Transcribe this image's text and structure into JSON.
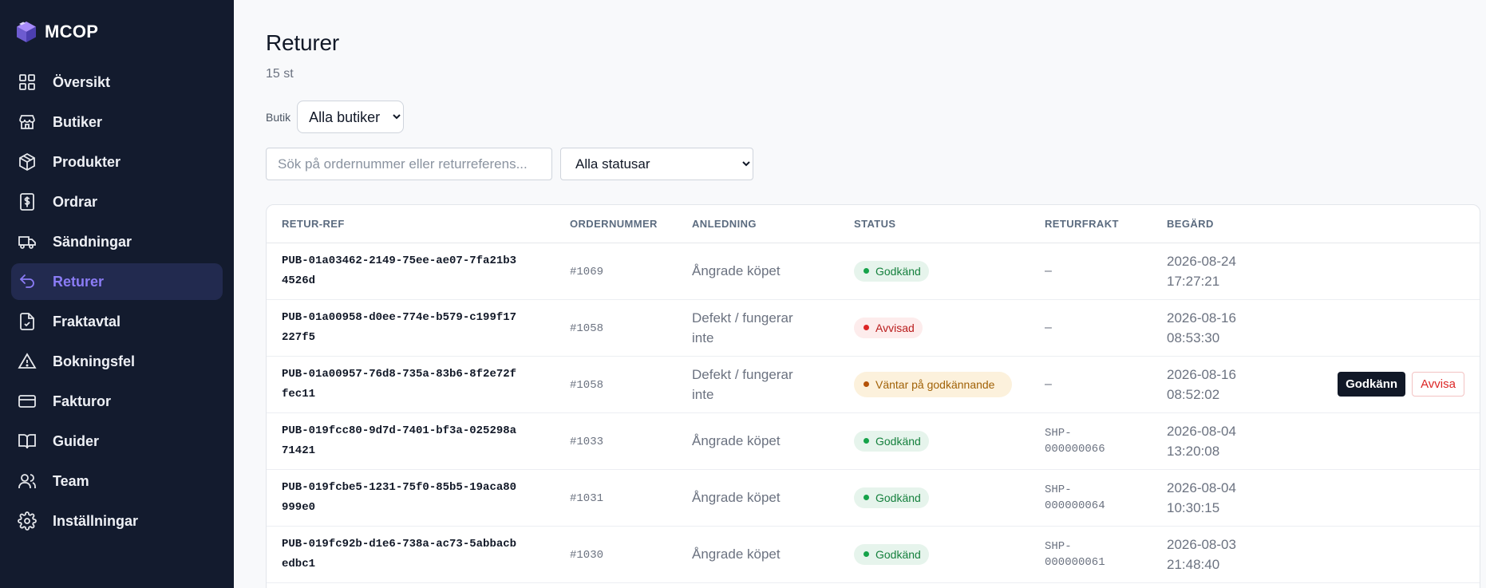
{
  "brand": {
    "name": "MCOP"
  },
  "sidebar": {
    "items": [
      {
        "label": "Översikt",
        "icon": "grid-icon"
      },
      {
        "label": "Butiker",
        "icon": "store-icon"
      },
      {
        "label": "Produkter",
        "icon": "package-icon"
      },
      {
        "label": "Ordrar",
        "icon": "dollar-document-icon"
      },
      {
        "label": "Sändningar",
        "icon": "truck-icon"
      },
      {
        "label": "Returer",
        "icon": "return-arrow-icon",
        "active": true
      },
      {
        "label": "Fraktavtal",
        "icon": "contract-icon"
      },
      {
        "label": "Bokningsfel",
        "icon": "warning-icon"
      },
      {
        "label": "Fakturor",
        "icon": "credit-card-icon"
      },
      {
        "label": "Guider",
        "icon": "book-icon"
      },
      {
        "label": "Team",
        "icon": "users-icon"
      },
      {
        "label": "Inställningar",
        "icon": "gear-icon"
      }
    ]
  },
  "page": {
    "title": "Returer",
    "count": "15 st"
  },
  "filters": {
    "shop_label": "Butik",
    "shop_value": "Alla butiker",
    "search_placeholder": "Sök på ordernummer eller returreferens...",
    "status_value": "Alla statusar"
  },
  "table": {
    "headers": {
      "ref": "RETUR-REF",
      "order": "ORDERNUMMER",
      "reason": "ANLEDNING",
      "status": "STATUS",
      "freight": "RETURFRAKT",
      "date": "BEGÄRD"
    },
    "actions": {
      "approve": "Godkänn",
      "reject": "Avvisa"
    },
    "rows": [
      {
        "ref": "PUB-01a03462-2149-75ee-ae07-7fa21b34526d",
        "order": "#1069",
        "reason": "Ångrade köpet",
        "status": "Godkänd",
        "status_type": "approved",
        "freight": "–",
        "date": "2026-08-24 17:27:21"
      },
      {
        "ref": "PUB-01a00958-d0ee-774e-b579-c199f17227f5",
        "order": "#1058",
        "reason": "Defekt / fungerar inte",
        "status": "Avvisad",
        "status_type": "rejected",
        "freight": "–",
        "date": "2026-08-16 08:53:30"
      },
      {
        "ref": "PUB-01a00957-76d8-735a-83b6-8f2e72ffec11",
        "order": "#1058",
        "reason": "Defekt / fungerar inte",
        "status": "Väntar på godkännande",
        "status_type": "pending",
        "freight": "–",
        "date": "2026-08-16 08:52:02",
        "has_actions": true
      },
      {
        "ref": "PUB-019fcc80-9d7d-7401-bf3a-025298a71421",
        "order": "#1033",
        "reason": "Ångrade köpet",
        "status": "Godkänd",
        "status_type": "approved",
        "freight": "SHP-000000066",
        "date": "2026-08-04 13:20:08"
      },
      {
        "ref": "PUB-019fcbe5-1231-75f0-85b5-19aca80999e0",
        "order": "#1031",
        "reason": "Ångrade köpet",
        "status": "Godkänd",
        "status_type": "approved",
        "freight": "SHP-000000064",
        "date": "2026-08-04 10:30:15"
      },
      {
        "ref": "PUB-019fc92b-d1e6-738a-ac73-5abbacbedbc1",
        "order": "#1030",
        "reason": "Ångrade köpet",
        "status": "Godkänd",
        "status_type": "approved",
        "freight": "SHP-000000061",
        "date": "2026-08-03 21:48:40"
      }
    ]
  }
}
